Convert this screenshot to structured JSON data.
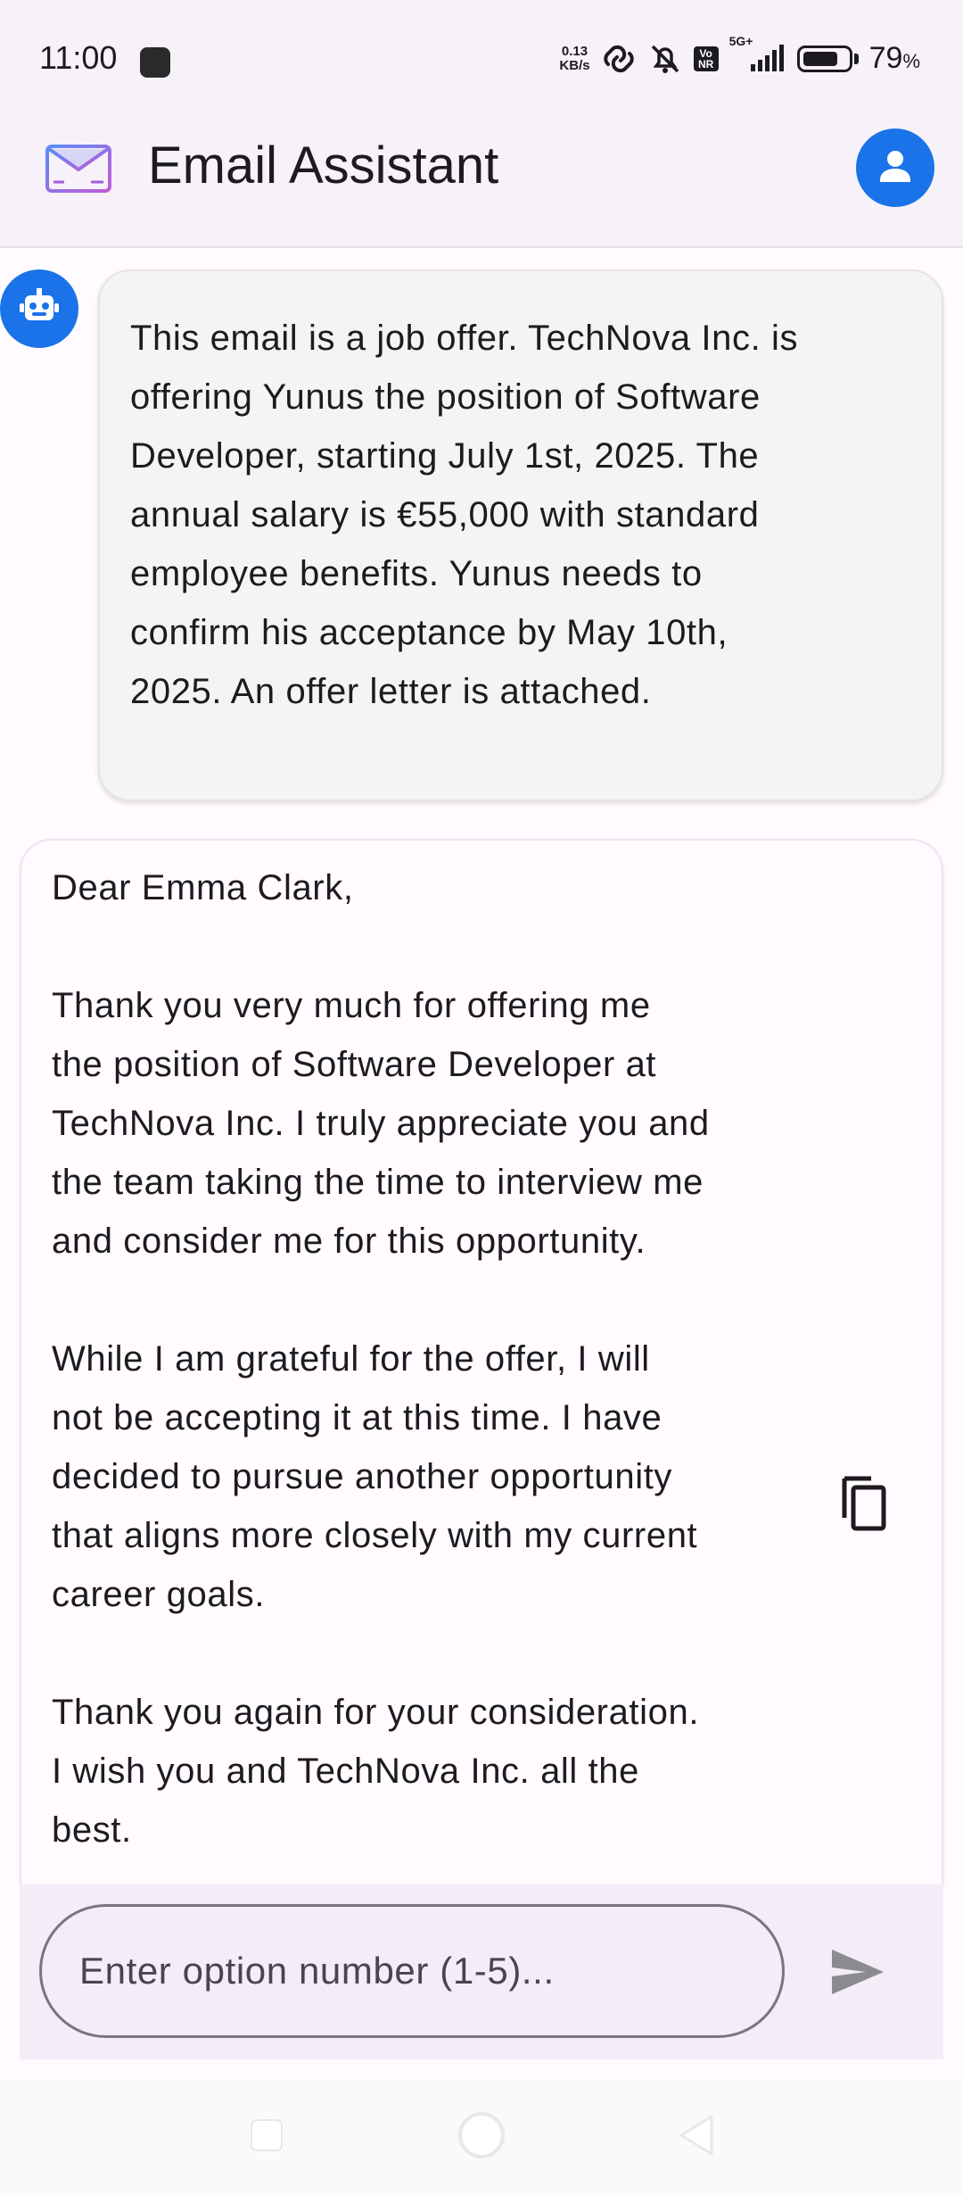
{
  "status_bar": {
    "time": "11:00",
    "net_speed_value": "0.13",
    "net_speed_unit": "KB/s",
    "network_label": "5G+",
    "volte_label": "Vo NR",
    "battery_percent": "79",
    "battery_percent_sign": "%",
    "battery_level": 0.79
  },
  "app_bar": {
    "title": "Email Assistant",
    "logo_icon": "envelope-icon",
    "profile_icon": "person-icon"
  },
  "chat": {
    "bot_icon": "robot-icon",
    "summary": "This email is a job offer. TechNova Inc. is\noffering Yunus the position of Software\nDeveloper, starting July 1st, 2025. The\nannual salary is €55,000 with standard\nemployee benefits. Yunus needs to\nconfirm his acceptance by May 10th,\n2025. An offer letter is attached.",
    "reply": "Dear Emma Clark,\n\nThank you very much for offering me\nthe position of Software Developer at\nTechNova Inc. I truly appreciate you and\nthe team taking the time to interview me\nand consider me for this opportunity.\n\nWhile I am grateful for the offer, I will\nnot be accepting it at this time. I have\ndecided to pursue another opportunity\nthat aligns more closely with my current\ncareer goals.\n\nThank you again for your consideration.\nI wish you and TechNova Inc. all the\nbest.",
    "copy_icon": "copy-icon"
  },
  "input": {
    "placeholder": "Enter option number (1-5)...",
    "value": "",
    "send_icon": "send-icon"
  },
  "colors": {
    "accent": "#1a73e8",
    "surface": "#f7f2fa",
    "bubble": "#f4f4f4"
  }
}
